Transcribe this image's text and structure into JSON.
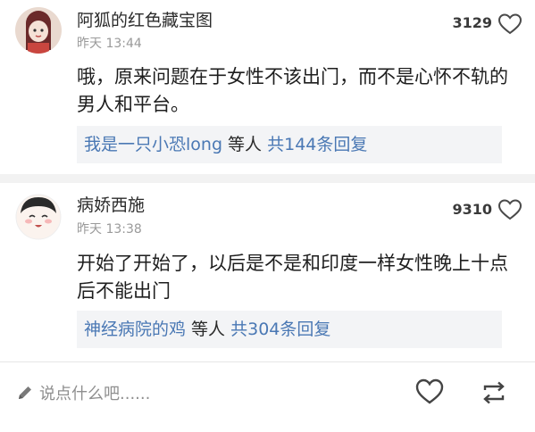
{
  "comments": [
    {
      "username": "阿狐的红色藏宝图",
      "time": "昨天 13:44",
      "likes": "3129",
      "content": "哦，原来问题在于女性不该出门，而不是心怀不轨的男人和平台。",
      "reply": {
        "user": "我是一只小恐long",
        "middle": " 等人 ",
        "count": "共144条回复"
      }
    },
    {
      "username": "病娇西施",
      "time": "昨天 13:38",
      "likes": "9310",
      "content": "开始了开始了，以后是不是和印度一样女性晚上十点后不能出门",
      "reply": {
        "user": "神经病院的鸡",
        "middle": " 等人 ",
        "count": "共304条回复"
      }
    }
  ],
  "bottom_bar": {
    "placeholder": "说点什么吧......"
  },
  "colors": {
    "link": "#4a78b4",
    "reply_bg": "#f3f4f6",
    "secondary_text": "#9a9a9a"
  },
  "icons": [
    "heart-icon",
    "pen-icon",
    "repost-icon"
  ]
}
